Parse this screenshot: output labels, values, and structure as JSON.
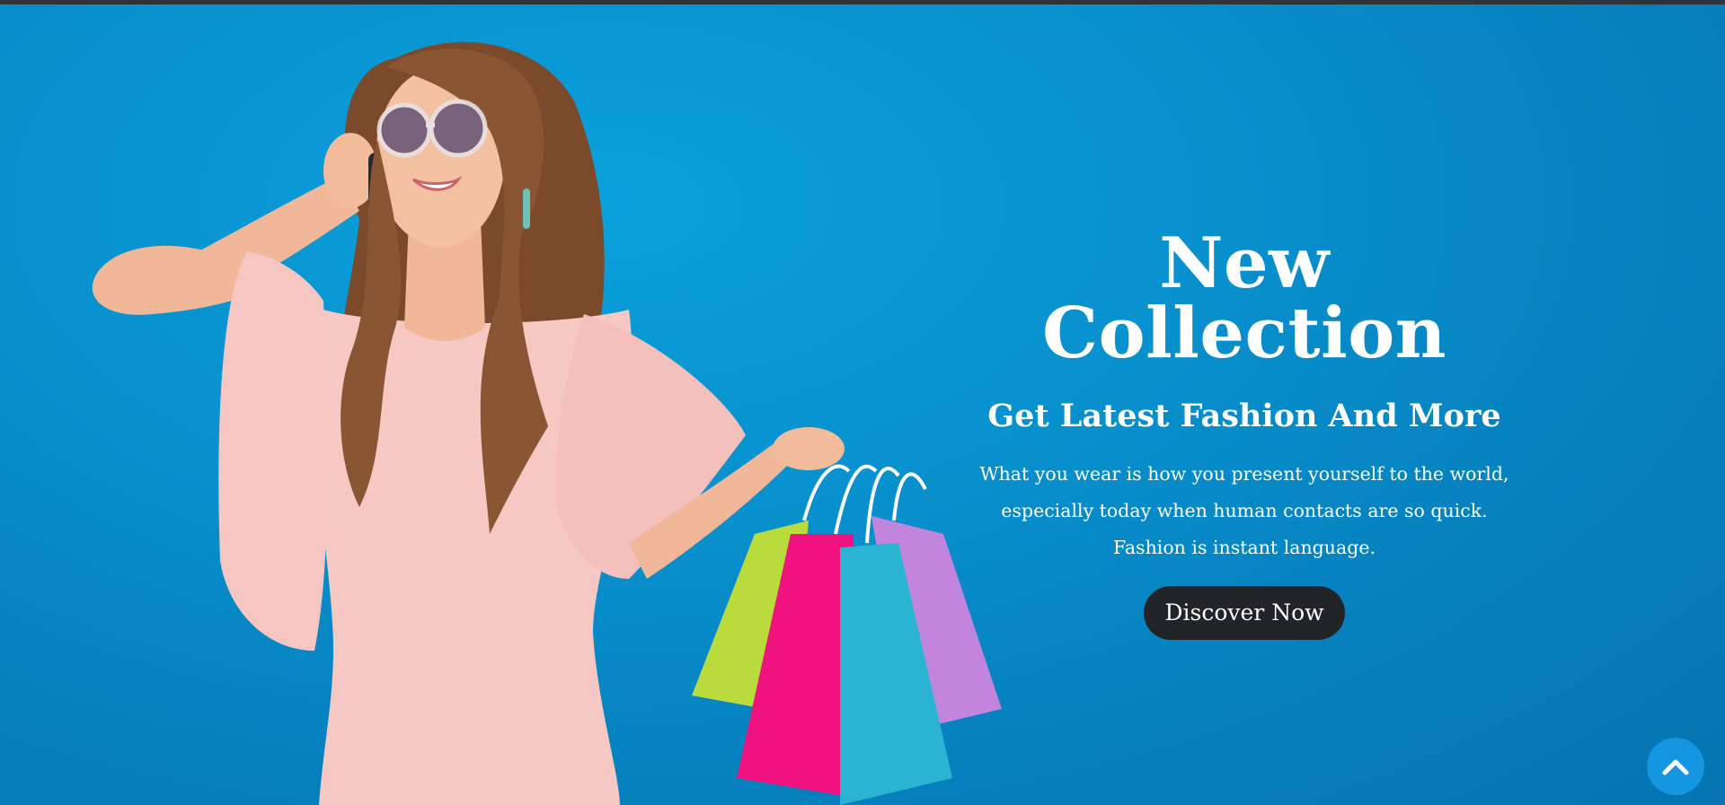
{
  "hero": {
    "title": "New Collection",
    "subtitle": "Get Latest Fashion And More",
    "description_lines": [
      "What you wear is how you present yourself to the world,",
      "especially today when human contacts are so quick.",
      "Fashion is instant language."
    ],
    "cta_label": "Discover Now",
    "background_color": "#0892cf"
  },
  "scroll_top": {
    "icon": "chevron-up-icon",
    "color": "#1496e0"
  },
  "image": {
    "subject": "woman in pink dress on phone holding shopping bags"
  },
  "colors": {
    "button_bg": "#222428",
    "text": "#ffffff",
    "dress": "#f4c2c0",
    "bag_green": "#b9dc3c",
    "bag_pink": "#f0127e",
    "bag_teal": "#2bb3d4",
    "bag_purple": "#c285dd"
  }
}
